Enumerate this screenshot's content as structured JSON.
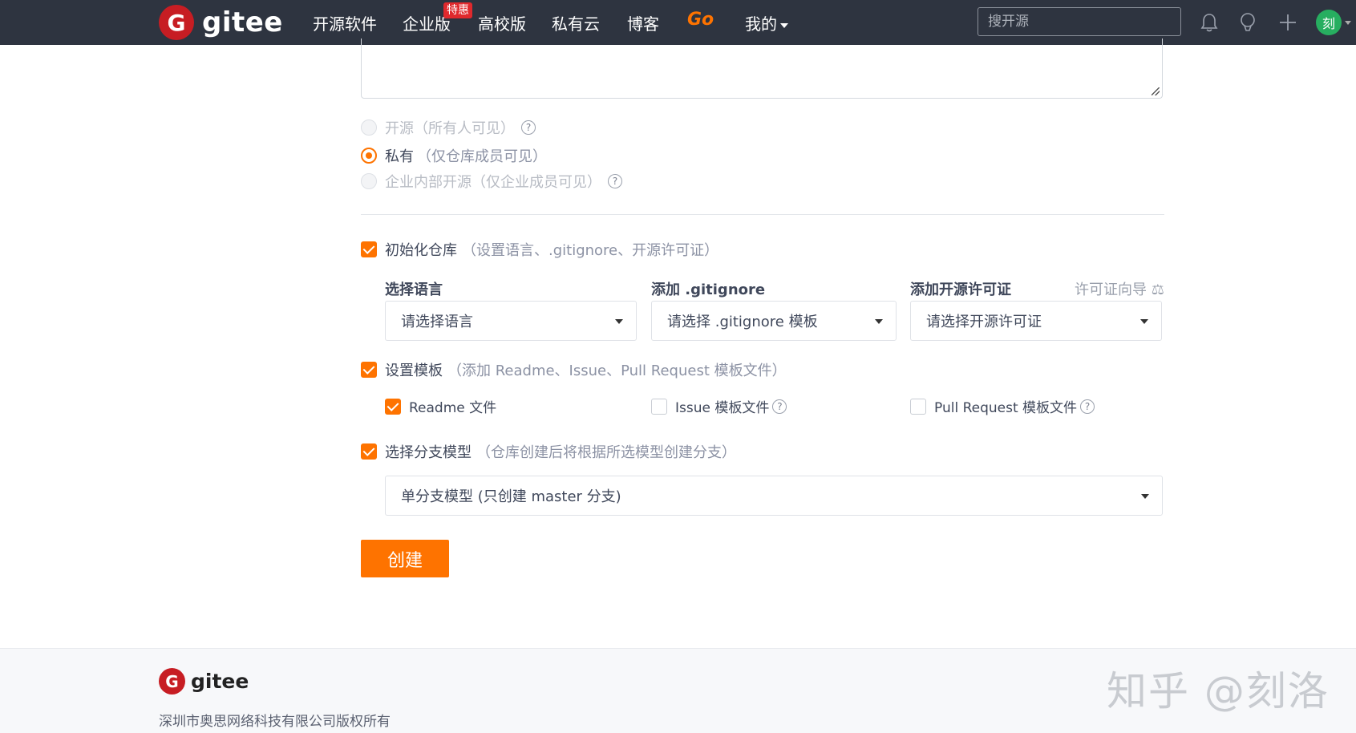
{
  "nav": {
    "logo_letter": "G",
    "logo_text": "gitee",
    "items": [
      "开源软件",
      "企业版",
      "高校版",
      "私有云",
      "博客"
    ],
    "badge": "特惠",
    "go": "Go",
    "mine": "我的",
    "search_placeholder": "搜开源",
    "avatar_text": "刻"
  },
  "visibility": {
    "open": {
      "label": "开源",
      "hint": "（所有人可见）"
    },
    "private": {
      "label": "私有",
      "hint": "（仅仓库成员可见）"
    },
    "enterprise": {
      "label": "企业内部开源",
      "hint": "（仅企业成员可见）"
    }
  },
  "init": {
    "label": "初始化仓库",
    "hint": "（设置语言、.gitignore、开源许可证）",
    "lang_label": "选择语言",
    "lang_value": "请选择语言",
    "gitignore_label": "添加 .gitignore",
    "gitignore_value": "请选择 .gitignore 模板",
    "license_label": "添加开源许可证",
    "license_value": "请选择开源许可证",
    "license_guide": "许可证向导 ⚖"
  },
  "template": {
    "label": "设置模板",
    "hint": "（添加 Readme、Issue、Pull Request 模板文件）",
    "readme": "Readme 文件",
    "issue": "Issue 模板文件",
    "pr": "Pull Request 模板文件"
  },
  "branch": {
    "label": "选择分支模型",
    "hint": "（仓库创建后将根据所选模型创建分支）",
    "value": "单分支模型 (只创建 master 分支)"
  },
  "create_button": "创建",
  "footer": {
    "logo_text": "gitee",
    "copyright": "深圳市奥思网络科技有限公司版权所有",
    "watermark": "知乎 @刻洛"
  }
}
